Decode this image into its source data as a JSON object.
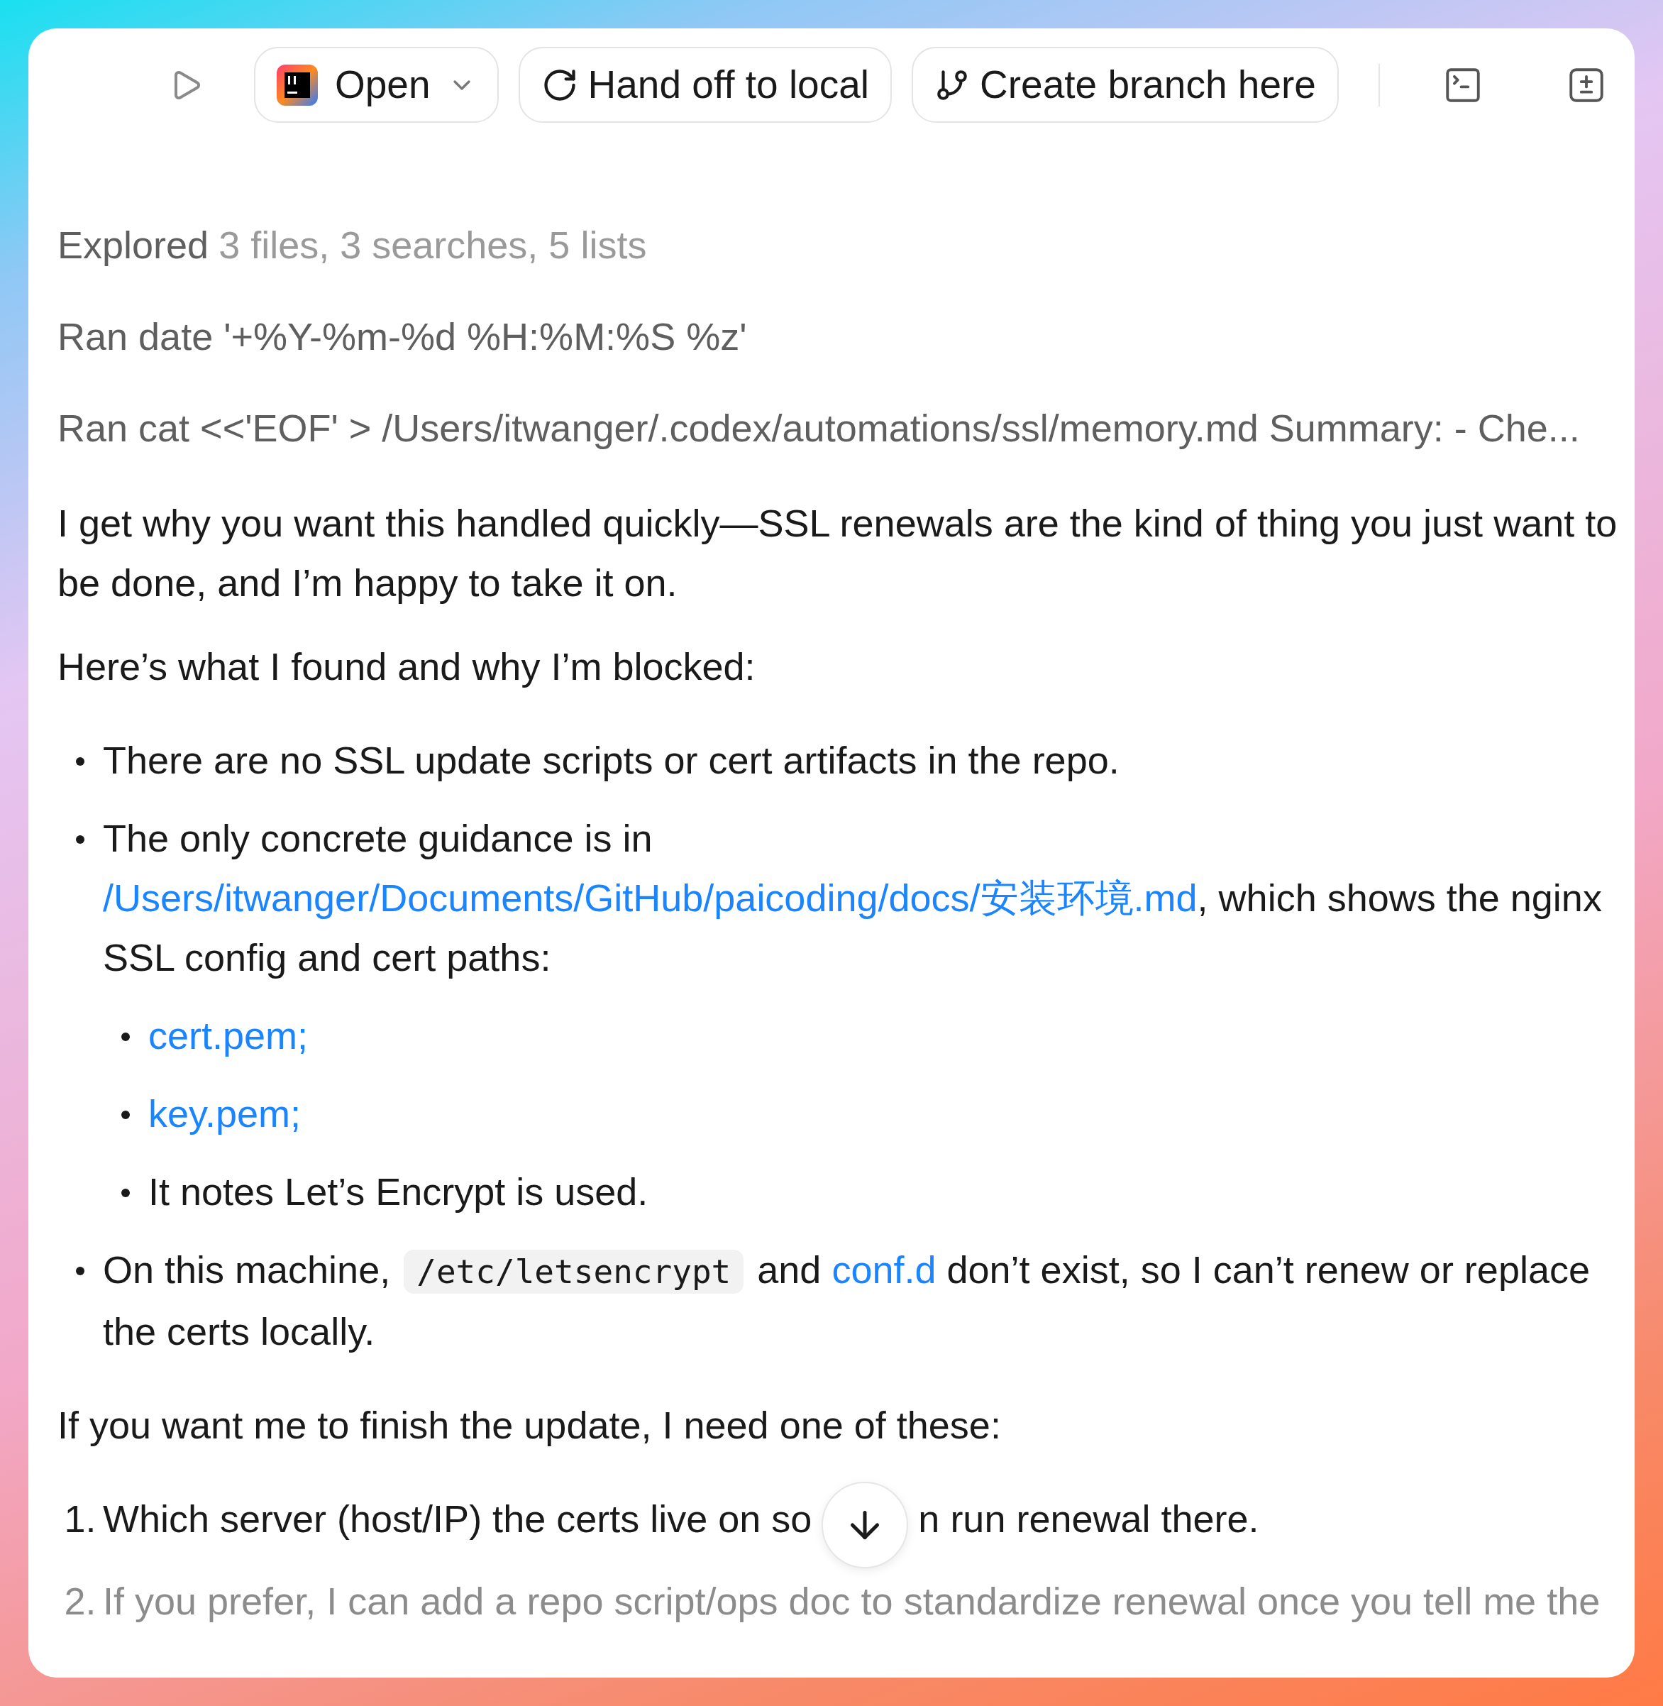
{
  "toolbar": {
    "buttons": [
      {
        "kind": "open",
        "label": "Open"
      },
      {
        "kind": "handoff",
        "label": "Hand off to local"
      },
      {
        "kind": "branch",
        "label": "Create branch here"
      }
    ]
  },
  "activity": [
    {
      "label": "Explored",
      "detail": "3 files, 3 searches, 5 lists"
    },
    {
      "label": "Ran date '+%Y-%m-%d %H:%M:%S %z'"
    },
    {
      "label": "Ran cat <<'EOF' > /Users/itwanger/.codex/automations/ssl/memory.md Summary: - Che..."
    }
  ],
  "message": [
    {
      "kind": "paragraph",
      "parts": [
        {
          "kind": "text",
          "text": "I get why you want this handled quickly—SSL renewals are the kind of thing you just want to be done, and I’m happy to take it on."
        }
      ]
    },
    {
      "kind": "paragraph",
      "parts": [
        {
          "kind": "text",
          "text": "Here’s what I found and why I’m blocked:"
        }
      ]
    },
    {
      "kind": "bullets",
      "items": [
        {
          "parts": [
            {
              "kind": "text",
              "text": "There are no SSL update scripts or cert artifacts in the repo."
            }
          ]
        },
        {
          "parts": [
            {
              "kind": "text",
              "text": "The only concrete guidance is in "
            },
            {
              "kind": "link",
              "text": "/Users/itwanger/Documents/GitHub/paicoding/docs/安装环境.md"
            },
            {
              "kind": "text",
              "text": ", which shows the nginx SSL config and cert paths:"
            }
          ],
          "children": [
            {
              "parts": [
                {
                  "kind": "link",
                  "text": "cert.pem;"
                }
              ]
            },
            {
              "parts": [
                {
                  "kind": "link",
                  "text": "key.pem;"
                }
              ]
            },
            {
              "parts": [
                {
                  "kind": "text",
                  "text": "It notes Let’s Encrypt is used."
                }
              ]
            }
          ]
        },
        {
          "parts": [
            {
              "kind": "text",
              "text": "On this machine, "
            },
            {
              "kind": "code",
              "text": "/etc/letsencrypt"
            },
            {
              "kind": "text",
              "text": " and "
            },
            {
              "kind": "link",
              "text": "conf.d"
            },
            {
              "kind": "text",
              "text": " don’t exist, so I can’t renew or replace the certs locally."
            }
          ]
        }
      ]
    },
    {
      "kind": "paragraph",
      "parts": [
        {
          "kind": "text",
          "text": "If you want me to finish the update, I need one of these:"
        }
      ]
    },
    {
      "kind": "numbered",
      "items": [
        {
          "marker": "1.",
          "faded": false,
          "parts": [
            {
              "kind": "text",
              "text": "Which server (host/IP) the certs live on so"
            },
            {
              "kind": "covered"
            },
            {
              "kind": "text",
              "text": "n run renewal there."
            }
          ]
        },
        {
          "marker": "2.",
          "faded": true,
          "parts": [
            {
              "kind": "text",
              "text": "If you prefer, I can add a repo script/ops doc to standardize renewal once you tell me the"
            }
          ]
        }
      ]
    }
  ]
}
